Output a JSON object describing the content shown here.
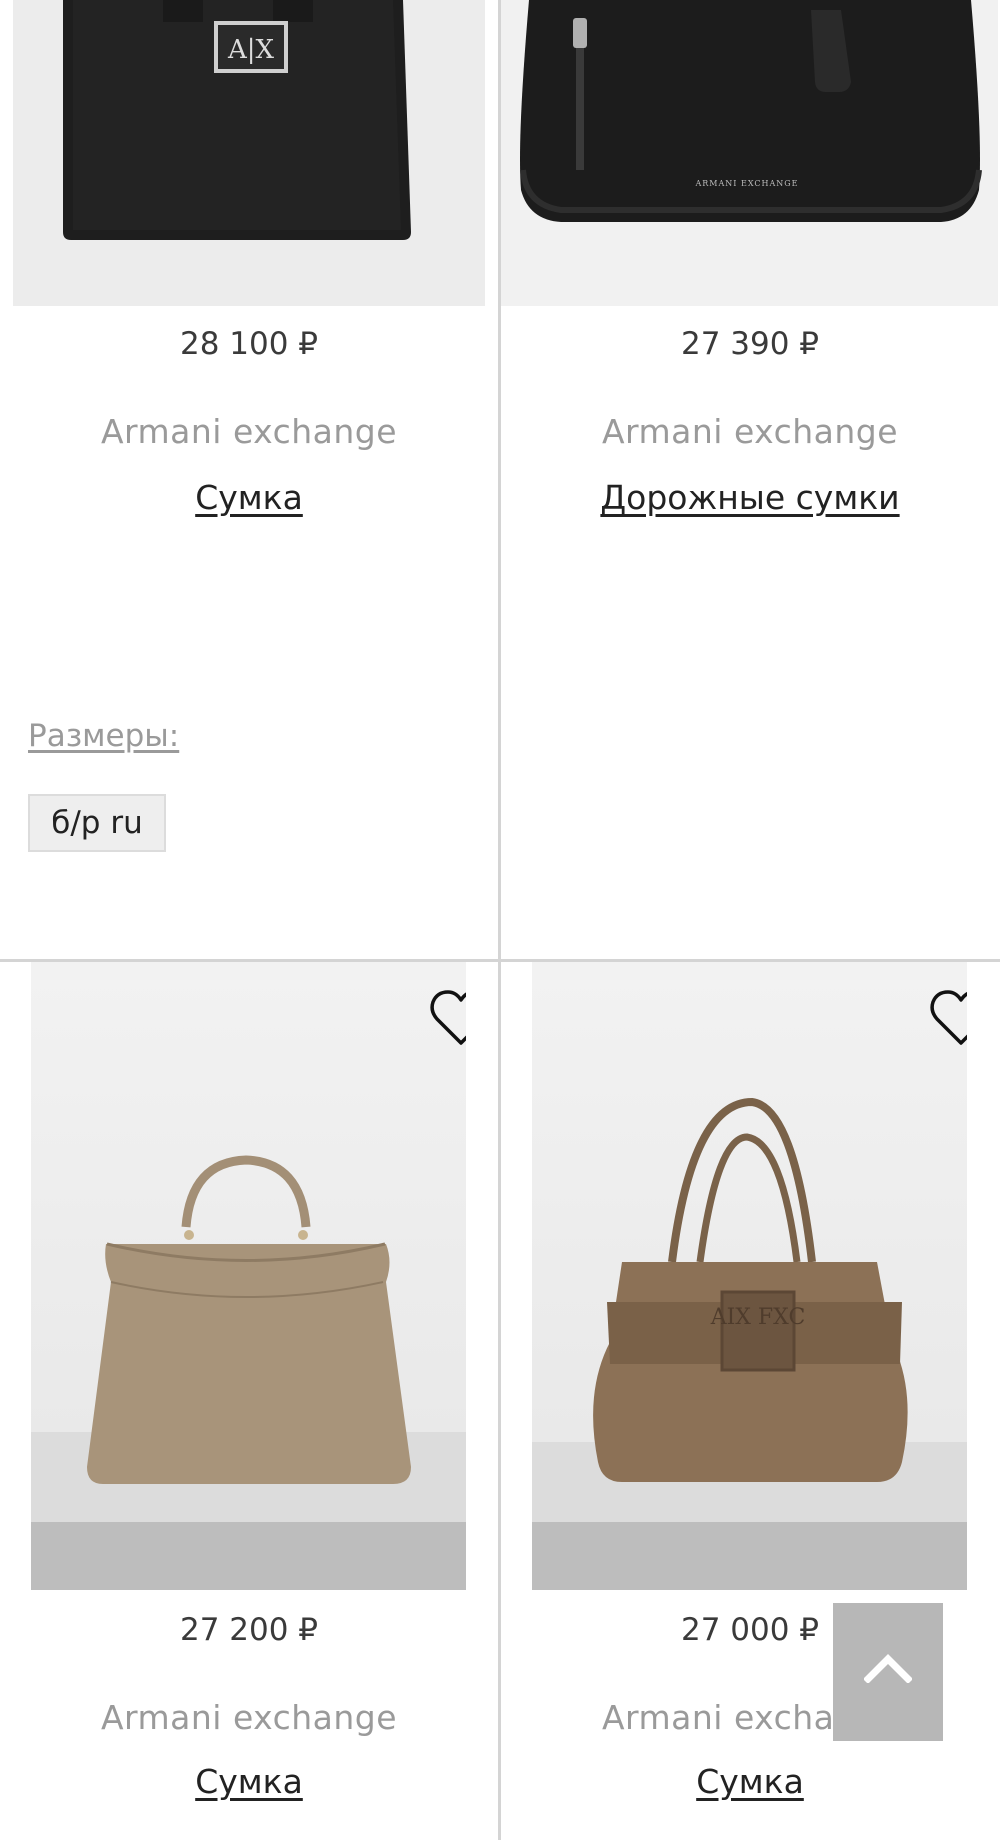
{
  "products": [
    {
      "price": "28 100 ₽",
      "brand": "Armani exchange",
      "name": "Сумка",
      "sizes_label": "Размеры:",
      "sizes": [
        "б/р ru"
      ],
      "logo_text": "A|X"
    },
    {
      "price": "27 390 ₽",
      "brand": "Armani exchange",
      "name": "Дорожные сумки",
      "logo_text": "ARMANI EXCHANGE"
    },
    {
      "price": "27 200 ₽",
      "brand": "Armani exchange",
      "name": "Сумка",
      "favorite_icon": "heart-outline-icon"
    },
    {
      "price": "27 000 ₽",
      "brand": "Armani exchange",
      "name": "Сумка",
      "favorite_icon": "heart-outline-icon",
      "logo_text": "AIX FXC"
    }
  ],
  "scroll_top": {
    "icon": "chevron-up-icon"
  },
  "colors": {
    "divider": "#d4d4d4",
    "brand_text": "#9a9a9a",
    "scroll_button": "#b7b7b7"
  }
}
